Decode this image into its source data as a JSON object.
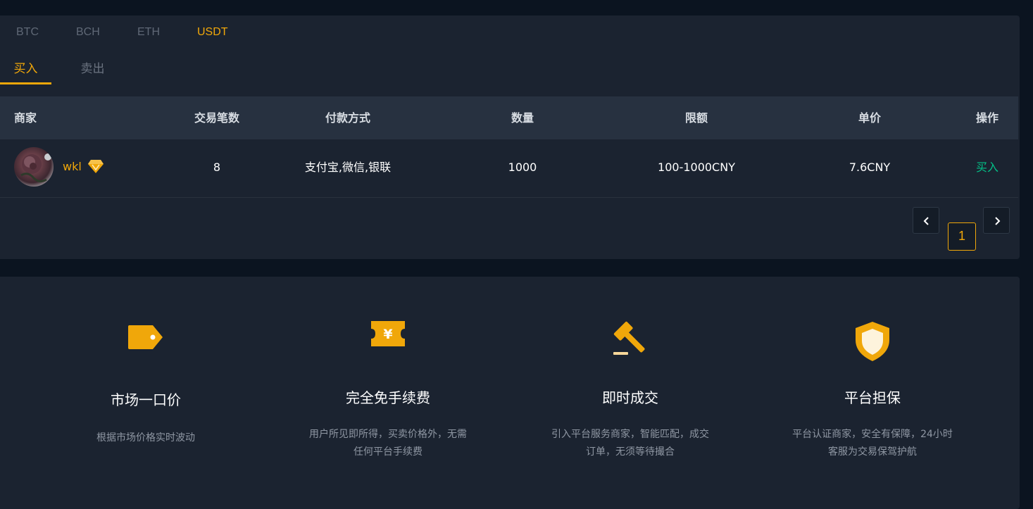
{
  "coins": [
    "BTC",
    "BCH",
    "ETH",
    "USDT"
  ],
  "active_coin": "USDT",
  "side_tabs": [
    "买入",
    "卖出"
  ],
  "active_side": "买入",
  "table": {
    "headers": [
      "商家",
      "交易笔数",
      "付款方式",
      "数量",
      "限额",
      "单价",
      "操作"
    ],
    "rows": [
      {
        "merchant": "wkl",
        "trades": "8",
        "payment": "支付宝,微信,银联",
        "amount": "1000",
        "limit": "100-1000CNY",
        "price": "7.6CNY",
        "action": "买入"
      }
    ]
  },
  "pagination": {
    "current_page": "1"
  },
  "features": [
    {
      "icon": "price-tag-icon",
      "title": "市场一口价",
      "desc_lines": [
        "根据市场价格实时波动"
      ]
    },
    {
      "icon": "fee-ticket-icon",
      "title": "完全免手续费",
      "desc_lines": [
        "用户所见即所得，买卖价格外，无需",
        "任何平台手续费"
      ]
    },
    {
      "icon": "gavel-icon",
      "title": "即时成交",
      "desc_lines": [
        "引入平台服务商家，智能匹配，成交",
        "订单，无须等待撮合"
      ]
    },
    {
      "icon": "shield-icon",
      "title": "平台担保",
      "desc_lines": [
        "平台认证商家，安全有保障，24小时",
        "客服为交易保驾护航"
      ]
    }
  ],
  "colors": {
    "accent": "#f0a70a",
    "buy_green": "#03c087",
    "panel_bg": "#1b2330",
    "page_bg": "#0b1420",
    "header_bg": "#273140"
  }
}
